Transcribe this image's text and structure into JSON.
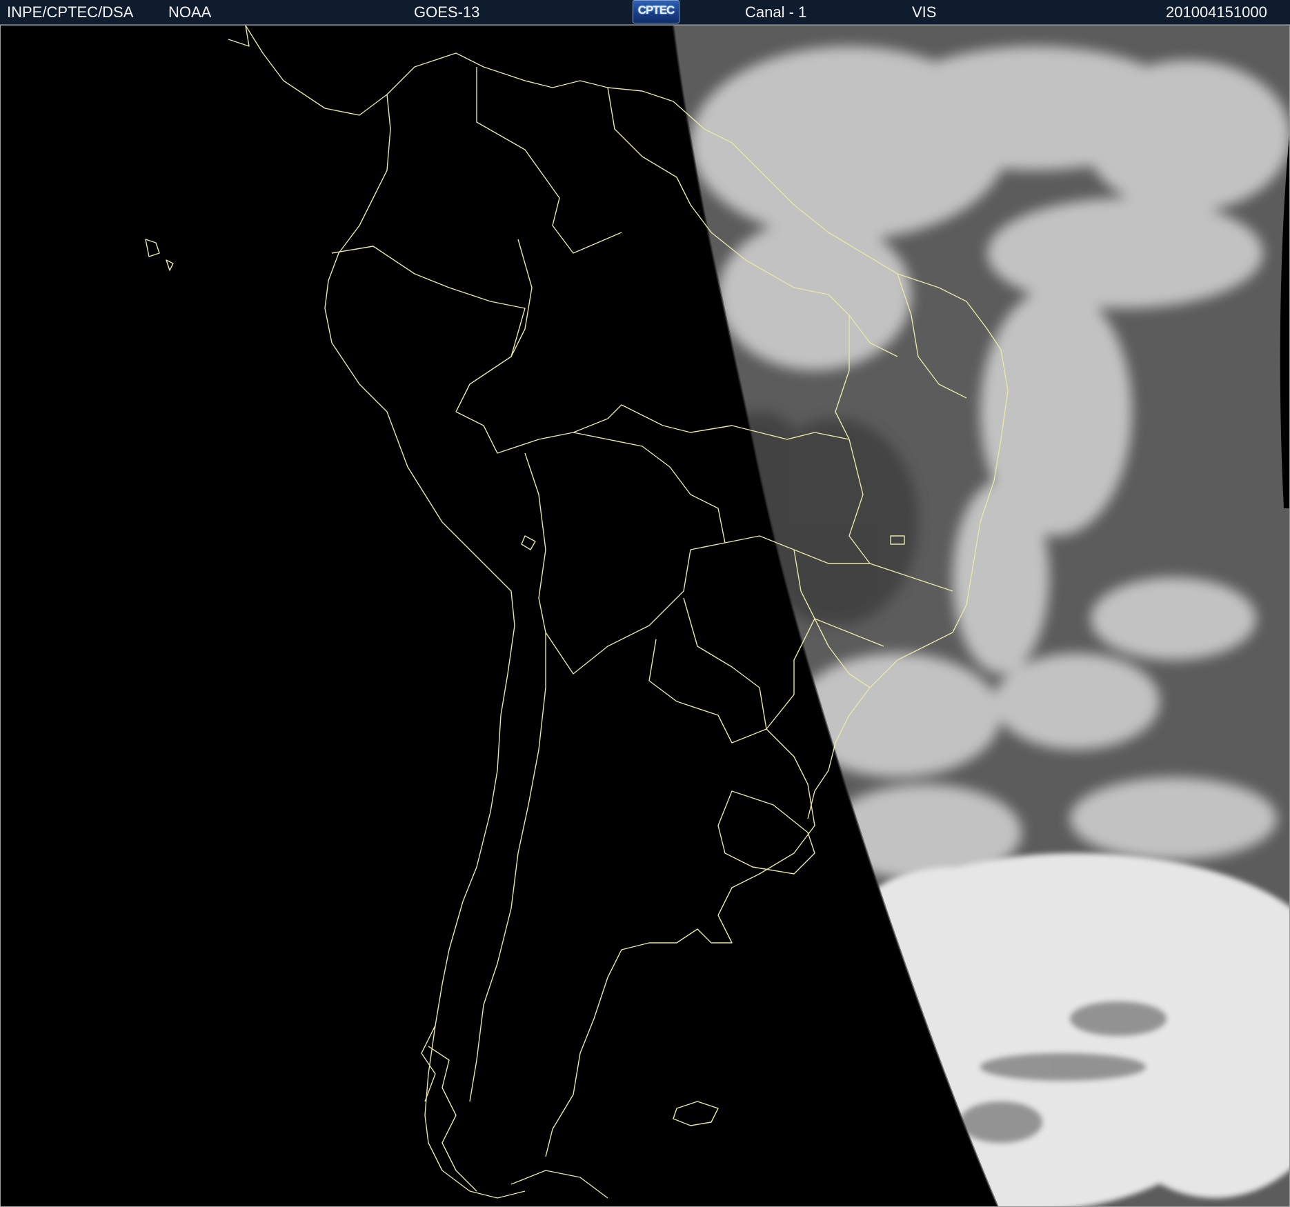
{
  "header": {
    "agency": "INPE/CPTEC/DSA",
    "source": "NOAA",
    "satellite": "GOES-13",
    "logo_text": "CPTEC",
    "channel": "Canal - 1",
    "band": "VIS",
    "datetime": "201004151000"
  },
  "map": {
    "region": "South America",
    "imagery_type": "visible satellite",
    "background_color": "#000000",
    "border_color": "#e8e6a8",
    "cloud_color": "#d8d8d8",
    "ocean_gray": "#5a5a5a"
  },
  "icons": {
    "logo": "cptec-logo"
  }
}
